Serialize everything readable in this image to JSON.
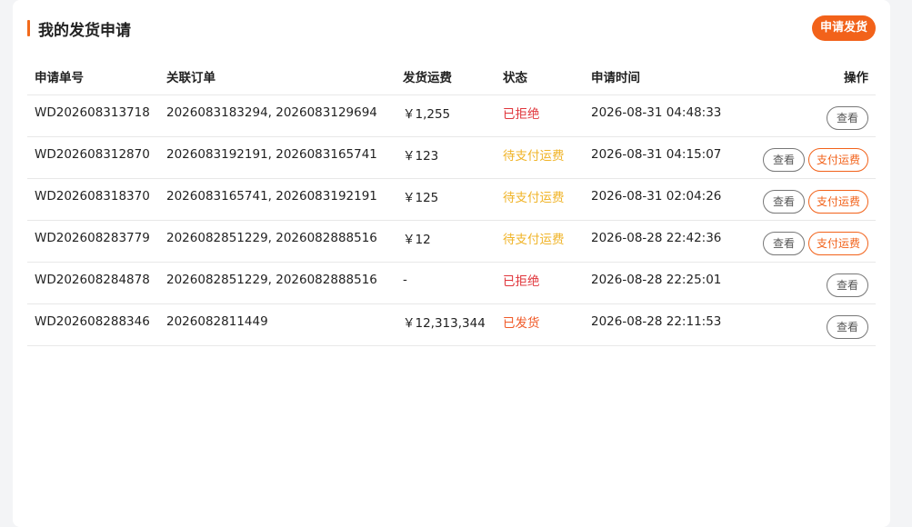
{
  "page": {
    "title": "我的发货申请",
    "apply_button": "申请发货"
  },
  "colors": {
    "accent": "#f2621a",
    "rejected": "#e0353b",
    "pending": "#f0b429",
    "shipped": "#f05a28"
  },
  "table": {
    "headers": [
      "申请单号",
      "关联订单",
      "发货运费",
      "状态",
      "申请时间",
      "操作"
    ],
    "view_label": "查看",
    "pay_label": "支付运费",
    "rows": [
      {
        "id": "WD202608313718",
        "orders": "2026083183294, 2026083129694",
        "fee": "￥1,255",
        "status": "已拒绝",
        "status_type": "rejected",
        "time": "2026-08-31 04:48:33",
        "can_pay": false
      },
      {
        "id": "WD202608312870",
        "orders": "2026083192191, 2026083165741",
        "fee": "￥123",
        "status": "待支付运费",
        "status_type": "pending",
        "time": "2026-08-31 04:15:07",
        "can_pay": true
      },
      {
        "id": "WD202608318370",
        "orders": "2026083165741, 2026083192191",
        "fee": "￥125",
        "status": "待支付运费",
        "status_type": "pending",
        "time": "2026-08-31 02:04:26",
        "can_pay": true
      },
      {
        "id": "WD202608283779",
        "orders": "2026082851229, 2026082888516",
        "fee": "￥12",
        "status": "待支付运费",
        "status_type": "pending",
        "time": "2026-08-28 22:42:36",
        "can_pay": true
      },
      {
        "id": "WD202608284878",
        "orders": "2026082851229, 2026082888516",
        "fee": "-",
        "status": "已拒绝",
        "status_type": "rejected",
        "time": "2026-08-28 22:25:01",
        "can_pay": false
      },
      {
        "id": "WD202608288346",
        "orders": "2026082811449",
        "fee": "￥12,313,344",
        "status": "已发货",
        "status_type": "shipped",
        "time": "2026-08-28 22:11:53",
        "can_pay": false
      }
    ]
  }
}
